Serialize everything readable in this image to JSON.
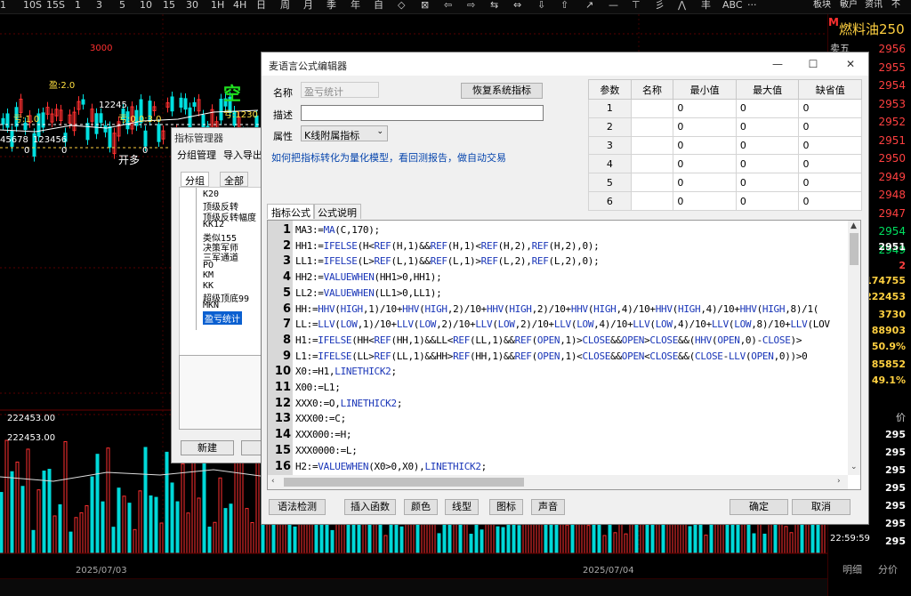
{
  "toolbar": {
    "items": [
      "1",
      "10S",
      "15S",
      "1",
      "3",
      "5",
      "10",
      "15",
      "30",
      "1H",
      "4H",
      "日",
      "周",
      "月",
      "季",
      "年",
      "自",
      "◇",
      "⊠",
      "⇦",
      "⇨",
      "⇆",
      "⇔",
      "⇩",
      "⇧",
      "↗",
      "—",
      "⊤",
      "彡",
      "⋀",
      "丰",
      "ABC",
      "···"
    ],
    "right_items": [
      "板块",
      "敏户",
      "资讯",
      "不"
    ]
  },
  "chart": {
    "labels": {
      "top_mark": "3000",
      "profit_2": "盈:2.0",
      "loss_1": "亏:1.0",
      "v12245": "12245",
      "ratio": "亏:0.0:3.0",
      "nums_left": "45678",
      "v123456": "123456",
      "zero_a": "0",
      "zero_b": "0",
      "zero_c": "0",
      "open_long": "开多",
      "kong": "空",
      "kong_right": "亏:1230",
      "ind_1": "222453.00",
      "ind_2": "222453.00",
      "date_1": "2025/07/03",
      "date_2": "2025/07/04"
    }
  },
  "quote_panel": {
    "header_mark": "M",
    "contract": "燃料油250",
    "sell_label": "卖五",
    "prices": [
      "2956",
      "2955",
      "2954",
      "2953",
      "2952",
      "2951",
      "2950",
      "2949",
      "2948",
      "2947",
      "2954",
      "2949"
    ],
    "last": "2951",
    "chg": "2",
    "vol": "174755",
    "oi": "222453",
    "cur": "3730",
    "amt": "88903",
    "pct": "50.9%",
    "v2": "85852",
    "pct2": "49.1%",
    "right_list_header": "价",
    "right_list": [
      "295",
      "295",
      "295",
      "295",
      "295",
      "295",
      "295"
    ],
    "time": "22:59:59",
    "tabs": [
      "明细",
      "分价"
    ]
  },
  "manager": {
    "title": "指标管理器",
    "menu": [
      "分组管理",
      "导入导出"
    ],
    "tabs": [
      "分组",
      "全部"
    ],
    "tree": [
      "K20",
      "顶级反转",
      "顶级反转幅度",
      "KK12",
      "类似155",
      "决策军师",
      "三军通道",
      "PO",
      "KM",
      "KK",
      "超级顶底99",
      "MKN",
      "盈亏统计"
    ],
    "btn_new": "新建"
  },
  "dialog": {
    "title": "麦语言公式编辑器",
    "name_label": "名称",
    "name_value": "盈亏统计",
    "restore_button": "恢复系统指标",
    "desc_label": "描述",
    "desc_value": "",
    "attr_label": "属性",
    "attr_value": "K线附属指标",
    "help_link": "如何把指标转化为量化模型，看回测报告，做自动交易",
    "param_headers": [
      "参数",
      "名称",
      "最小值",
      "最大值",
      "缺省值"
    ],
    "params": [
      {
        "n": "1",
        "name": "",
        "min": "0",
        "max": "0",
        "def": "0"
      },
      {
        "n": "2",
        "name": "",
        "min": "0",
        "max": "0",
        "def": "0"
      },
      {
        "n": "3",
        "name": "",
        "min": "0",
        "max": "0",
        "def": "0"
      },
      {
        "n": "4",
        "name": "",
        "min": "0",
        "max": "0",
        "def": "0"
      },
      {
        "n": "5",
        "name": "",
        "min": "0",
        "max": "0",
        "def": "0"
      },
      {
        "n": "6",
        "name": "",
        "min": "0",
        "max": "0",
        "def": "0"
      }
    ],
    "tabs": [
      "指标公式",
      "公式说明"
    ],
    "code_lines": [
      "MA3:=MA(C,170);",
      "HH1:=IFELSE(H<REF(H,1)&&REF(H,1)<REF(H,2),REF(H,2),0);",
      "LL1:=IFELSE(L>REF(L,1)&&REF(L,1)>REF(L,2),REF(L,2),0);",
      "HH2:=VALUEWHEN(HH1>0,HH1);",
      "LL2:=VALUEWHEN(LL1>0,LL1);",
      "HH:=HHV(HIGH,1)/10+HHV(HIGH,2)/10+HHV(HIGH,2)/10+HHV(HIGH,4)/10+HHV(HIGH,4)/10+HHV(HIGH,8)/1(",
      "LL:=LLV(LOW,1)/10+LLV(LOW,2)/10+LLV(LOW,2)/10+LLV(LOW,4)/10+LLV(LOW,4)/10+LLV(LOW,8)/10+LLV(LOV",
      "H1:=IFELSE(HH<REF(HH,1)&&LL<REF(LL,1)&&REF(OPEN,1)>CLOSE&&OPEN>CLOSE&&(HHV(OPEN,0)-CLOSE)>",
      "L1:=IFELSE(LL>REF(LL,1)&&HH>REF(HH,1)&&REF(OPEN,1)<CLOSE&&OPEN<CLOSE&&(CLOSE-LLV(OPEN,0))>0",
      "X0:=H1,LINETHICK2;",
      "X00:=L1;",
      "XXX0:=O,LINETHICK2;",
      "XXX00:=C;",
      "XXX000:=H;",
      "XXX0000:=L;",
      "H2:=VALUEWHEN(X0>0,X0),LINETHICK2;"
    ],
    "buttons": {
      "check": "语法检测",
      "insert_fn": "插入函数",
      "color": "颜色",
      "line": "线型",
      "icon": "图标",
      "sound": "声音",
      "ok": "确定",
      "cancel": "取消"
    }
  }
}
